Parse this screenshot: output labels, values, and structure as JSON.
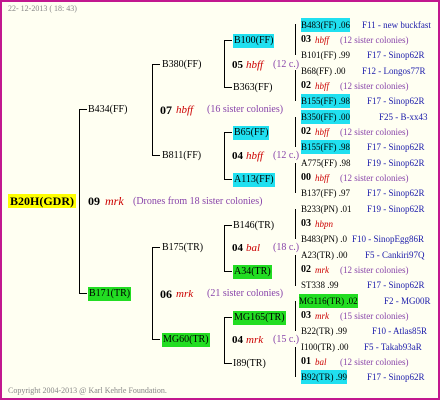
{
  "header": {
    "date": "22- 12-2013 ( 18: 43)"
  },
  "footer": {
    "copyright": "Copyright 2004-2013 @ Karl Kehrle Foundation."
  },
  "root": {
    "name": "B20H(GDR)",
    "gen": "09",
    "mark": "mrk",
    "note": "(Drones from 18 sister colonies)"
  },
  "g1": [
    {
      "name": "B434(FF)",
      "gen": "07",
      "mark": "hbff",
      "note": "(16 sister colonies)"
    },
    {
      "name": "B171(TR)",
      "gen": "06",
      "mark": "mrk",
      "note": "(21 sister colonies)"
    }
  ],
  "g2": [
    {
      "name": "B380(FF)",
      "gen": "05",
      "mark": "hbff",
      "note": "(12 c.)"
    },
    {
      "name": "B811(FF)",
      "gen": "04",
      "mark": "hbff",
      "note": "(12 c.)"
    },
    {
      "name": "B175(TR)",
      "gen": "04",
      "mark": "bal",
      "note": "(18 c.)"
    },
    {
      "name": "MG60(TR)",
      "gen": "04",
      "mark": "mrk",
      "note": "(15 c.)"
    }
  ],
  "g3": [
    "B100(FF)",
    "B363(FF)",
    "B65(FF)",
    "A113(FF)",
    "B146(TR)",
    "A34(TR)",
    "MG165(TR)",
    "I89(TR)"
  ],
  "g4": [
    {
      "a": "B483(FF) .06",
      "b": "F11 - new buckfast"
    },
    {
      "gen": "03",
      "mark": "hbff",
      "note": "(12 sister colonies)"
    },
    {
      "a": "B101(FF) .99",
      "b": "F17 - Sinop62R"
    },
    {
      "a": "B68(FF) .00",
      "b": "F12 - Longos77R"
    },
    {
      "gen": "02",
      "mark": "hbff",
      "note": "(12 sister colonies)"
    },
    {
      "a": "B155(FF) .98",
      "b": "F17 - Sinop62R"
    },
    {
      "a": "B350(FF) .00",
      "b": "F25 - B-xx43"
    },
    {
      "gen": "02",
      "mark": "hbff",
      "note": "(12 sister colonies)"
    },
    {
      "a": "B155(FF) .98",
      "b": "F17 - Sinop62R"
    },
    {
      "a": "A775(FF) .98",
      "b": "F19 - Sinop62R"
    },
    {
      "gen": "00",
      "mark": "hbff",
      "note": "(12 sister colonies)"
    },
    {
      "a": "B137(FF) .97",
      "b": "F17 - Sinop62R"
    },
    {
      "a": "B233(PN) .01",
      "b": "F19 - Sinop62R"
    },
    {
      "gen": "03",
      "mark": "hbpn",
      "note": ""
    },
    {
      "a": "B483(PN) .0",
      "b": "F10 - SinopEgg86R"
    },
    {
      "a": "A23(TR) .00",
      "b": "F5 - Cankiri97Q"
    },
    {
      "gen": "02",
      "mark": "mrk",
      "note": "(12 sister colonies)"
    },
    {
      "a": "ST338 .99",
      "b": "F17 - Sinop62R"
    },
    {
      "a": "MG116(TR) .02",
      "b": "F2 - MG00R"
    },
    {
      "gen": "03",
      "mark": "mrk",
      "note": "(15 sister colonies)"
    },
    {
      "a": "B22(TR) .99",
      "b": "F10 - Atlas85R"
    },
    {
      "a": "I100(TR) .00",
      "b": "F5 - Takab93aR"
    },
    {
      "gen": "01",
      "mark": "bal",
      "note": "(12 sister colonies)"
    },
    {
      "a": "B92(TR) .99",
      "b": "F17 - Sinop62R"
    }
  ],
  "colors": {
    "frame": "#c2188f",
    "cyan": "#20e0f0",
    "green": "#22dd22",
    "yellow": "#ffff00",
    "red": "#cc0000",
    "blue": "#1a1aaa",
    "purple": "#8844aa"
  }
}
